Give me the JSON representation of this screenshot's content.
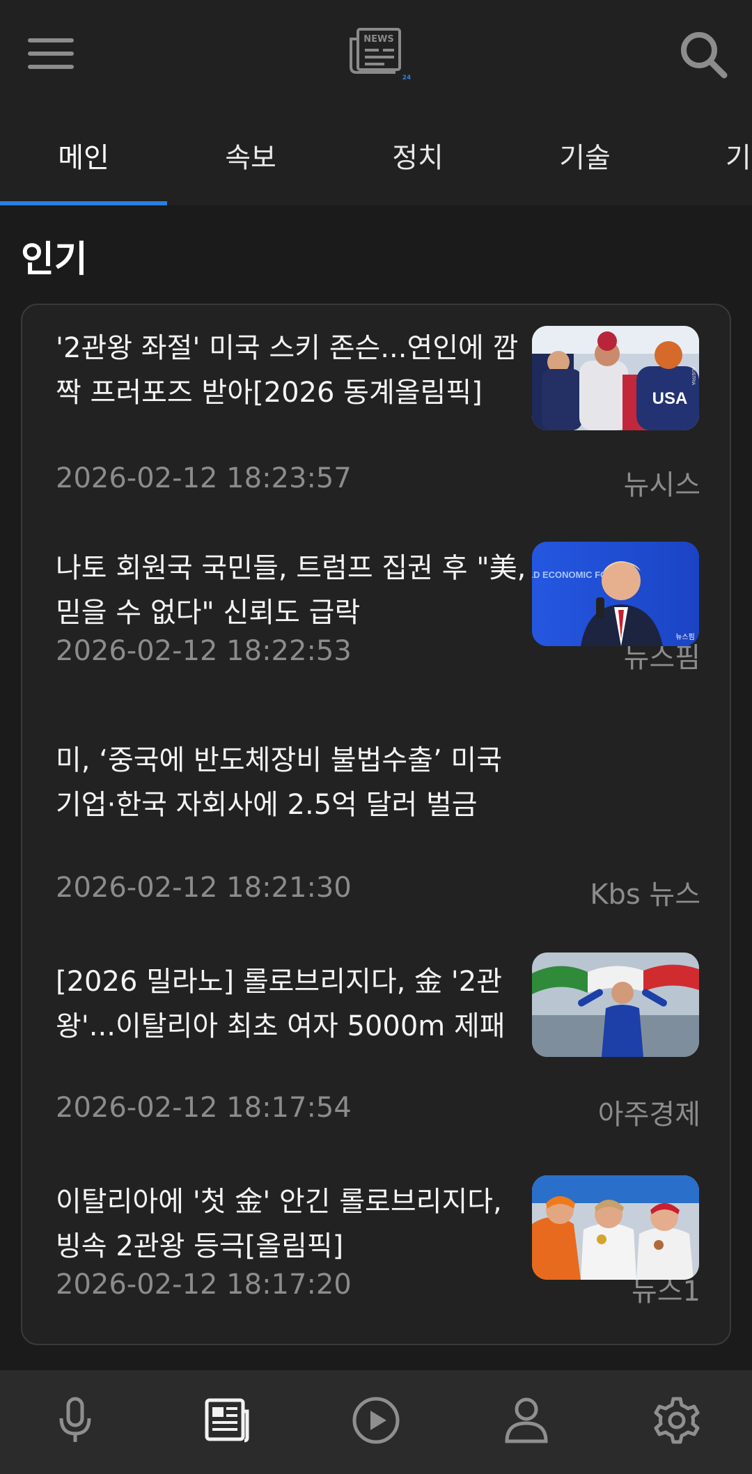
{
  "header": {
    "logo_text": "NEWS",
    "logo_sub": "24"
  },
  "tabs": [
    {
      "label": "메인",
      "active": true
    },
    {
      "label": "속보"
    },
    {
      "label": "정치"
    },
    {
      "label": "기술"
    },
    {
      "label": "기"
    }
  ],
  "section": {
    "title": "인기"
  },
  "articles": [
    {
      "headline": "'2관왕 좌절' 미국 스키 존슨...연인에 깜짝 프러포즈 받아[2026 동계올림픽]",
      "time": "2026-02-12 18:23:57",
      "source": "뉴시스",
      "has_image": true
    },
    {
      "headline": "나토 회원국 국민들, 트럼프 집권 후 \"美, 믿을 수 없다\" 신뢰도 급락",
      "time": "2026-02-12 18:22:53",
      "source": "뉴스핌",
      "has_image": true,
      "image_text": "WORLD ECONOMIC FORUM",
      "image_tag": "뉴스핌"
    },
    {
      "headline": "미, ‘중국에 반도체장비 불법수출’ 미국 기업·한국 자회사에 2.5억 달러 벌금",
      "time": "2026-02-12 18:21:30",
      "source": "Kbs 뉴스",
      "has_image": false
    },
    {
      "headline": "[2026 밀라노] 롤로브리지다, 金 '2관왕'...이탈리아 최초 여자 5000m 제패",
      "time": "2026-02-12 18:17:54",
      "source": "아주경제",
      "has_image": true
    },
    {
      "headline": "이탈리아에 '첫 金' 안긴 롤로브리지다, 빙속 2관왕 등극[올림픽]",
      "time": "2026-02-12 18:17:20",
      "source": "뉴스1",
      "has_image": true
    }
  ],
  "image_labels": {
    "usa": "USA",
    "usa_small": "AUSTRIA"
  },
  "bottom_nav": [
    {
      "icon": "microphone-icon"
    },
    {
      "icon": "newspaper-icon",
      "active": true
    },
    {
      "icon": "play-circle-icon"
    },
    {
      "icon": "person-icon"
    },
    {
      "icon": "gear-icon"
    }
  ],
  "colors": {
    "accent": "#2a7fe0",
    "background": "#1b1b1b",
    "card": "#222222",
    "muted_text": "#8c8c8c"
  }
}
